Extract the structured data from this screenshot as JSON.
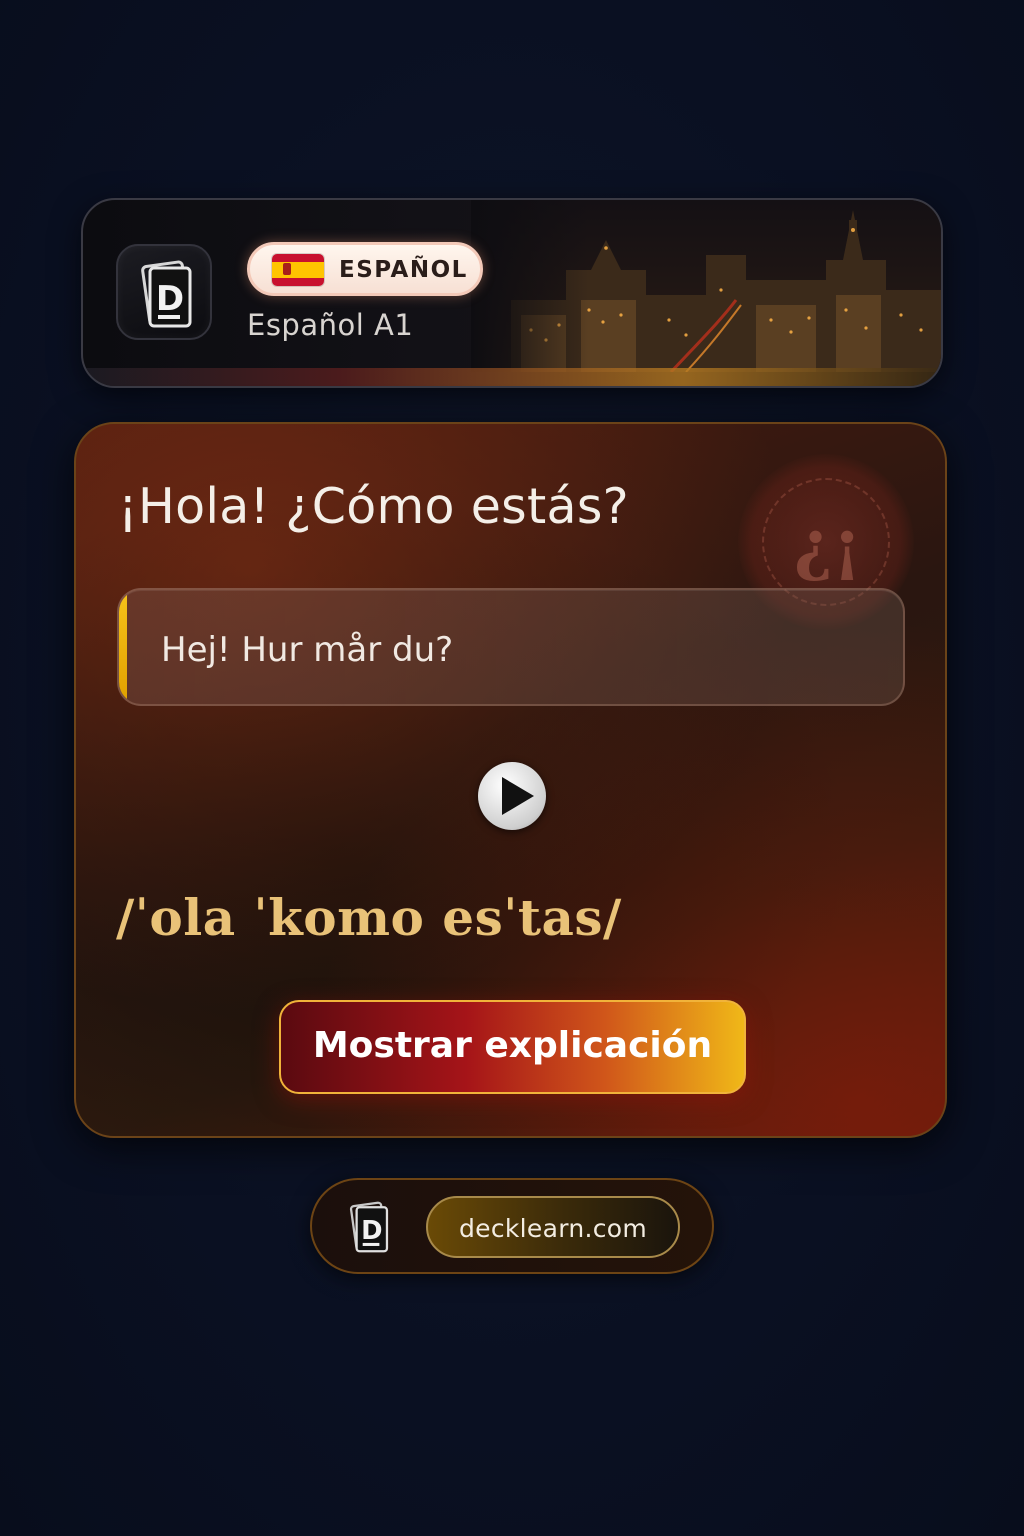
{
  "header": {
    "language_badge": "ESPAÑOL",
    "deck_name": "Español A1",
    "flag_icon": "spain-flag-icon"
  },
  "card": {
    "phrase": "¡Hola! ¿Cómo estás?",
    "translation": "Hej! Hur mår du?",
    "pronunciation": "/ˈola ˈkomo esˈtas/",
    "explain_button": "Mostrar explicación",
    "decoration_glyph": "¿¡",
    "accent_color": "#f6c21a"
  },
  "footer": {
    "site": "decklearn.com"
  }
}
